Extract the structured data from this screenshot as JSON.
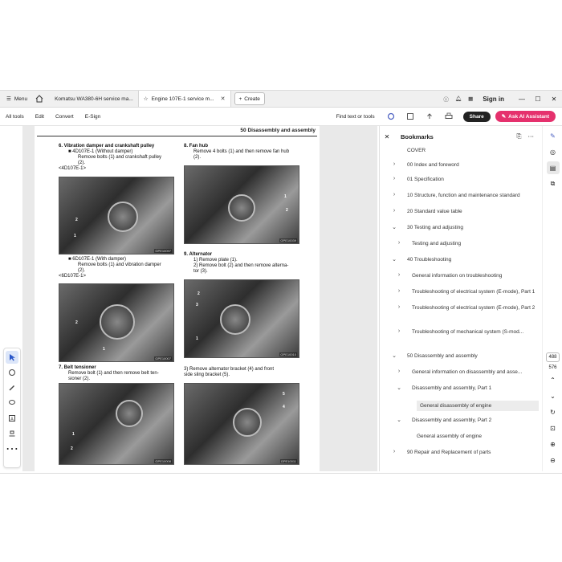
{
  "tabbar": {
    "menu_label": "Menu",
    "tabs": [
      {
        "label": "Komatsu WA380-6H service ma..."
      },
      {
        "label": "Engine 107E-1 service m..."
      }
    ],
    "create_label": "Create",
    "signin_label": "Sign in"
  },
  "toolbar": {
    "items": [
      "All tools",
      "Edit",
      "Convert",
      "E-Sign"
    ],
    "find_label": "Find text or tools",
    "share_label": "Share",
    "ai_label": "Ask AI Assistant"
  },
  "document": {
    "page_header": "50 Disassembly and assembly",
    "left_col": {
      "s6_title": "6.   Vibration damper and crankshaft pulley",
      "s6_b1": "■   4D107E-1 (Without damper)",
      "s6_b1_text1": "Remove bolts (1) and crankshaft pulley",
      "s6_b1_text2": "(2).",
      "s6_tag1": "<4D107E-1>",
      "s6_b2": "■   6D107E-1 (With damper)",
      "s6_b2_text1": "Remove bolts (1) and vibration damper",
      "s6_b2_text2": "(2).",
      "s6_tag2": "<6D107E-1>",
      "s7_title": "7.   Belt tensioner",
      "s7_text1": "Remove bolt (1) and then remove belt ten-",
      "s7_text2": "sioner (2).",
      "photo1_code": "GPE10097",
      "photo2_code": "GPE10007",
      "photo3_code": "GPE10008"
    },
    "right_col": {
      "s8_title": "8.   Fan hub",
      "s8_text1": "Remove 4 bolts (1) and then remove fan hub",
      "s8_text2": "(2).",
      "s9_title": "9.   Alternator",
      "s9_text1": "1)   Remove plate (1).",
      "s9_text2": "2)   Remove bolt (2) and then remove alterna-",
      "s9_text3": "      tor (3).",
      "s9_text4": "3)   Remove alternator bracket (4) and front",
      "s9_text5": "      side sling bracket (5).",
      "photo4_code": "GPE10039",
      "photo5_code": "GPE10010",
      "photo6_code": "GPE10011"
    }
  },
  "bookmarks": {
    "title": "Bookmarks",
    "items": [
      {
        "label": "COVER",
        "indent": 0,
        "chevron": ""
      },
      {
        "label": "00 Index and foreword",
        "indent": 0,
        "chevron": "›"
      },
      {
        "label": "01 Specification",
        "indent": 0,
        "chevron": "›"
      },
      {
        "label": "10 Structure, function and maintenance standard",
        "indent": 0,
        "chevron": "›"
      },
      {
        "label": "20 Standard value table",
        "indent": 0,
        "chevron": "›"
      },
      {
        "label": "30 Testing and adjusting",
        "indent": 0,
        "chevron": "⌄"
      },
      {
        "label": "Testing and adjusting",
        "indent": 1,
        "chevron": "›"
      },
      {
        "label": "40 Troubleshooting",
        "indent": 0,
        "chevron": "⌄"
      },
      {
        "label": "General information on troubleshooting",
        "indent": 1,
        "chevron": "›"
      },
      {
        "label": "Troubleshooting of electrical system (E-mode), Part 1",
        "indent": 1,
        "chevron": "›"
      },
      {
        "label": "Troubleshooting of electrical system (E-mode), Part 2",
        "indent": 1,
        "chevron": "›"
      },
      {
        "label": "Troubleshooting of mechanical system (S-mod...",
        "indent": 1,
        "chevron": "›"
      },
      {
        "label": "50 Disassembly and assembly",
        "indent": 0,
        "chevron": "⌄"
      },
      {
        "label": "General information on disassembly and asse...",
        "indent": 1,
        "chevron": "›"
      },
      {
        "label": "Disassembly and assembly, Part 1",
        "indent": 1,
        "chevron": "⌄"
      },
      {
        "label": "General disassembly of engine",
        "indent": 2,
        "chevron": "",
        "selected": true
      },
      {
        "label": "Disassembly and assembly, Part 2",
        "indent": 1,
        "chevron": "⌄"
      },
      {
        "label": "General assembly of engine",
        "indent": 2,
        "chevron": ""
      },
      {
        "label": "90 Repair and Replacement of parts",
        "indent": 0,
        "chevron": "›"
      }
    ]
  },
  "right_rail": {
    "page_current": "488",
    "page_total": "576"
  }
}
